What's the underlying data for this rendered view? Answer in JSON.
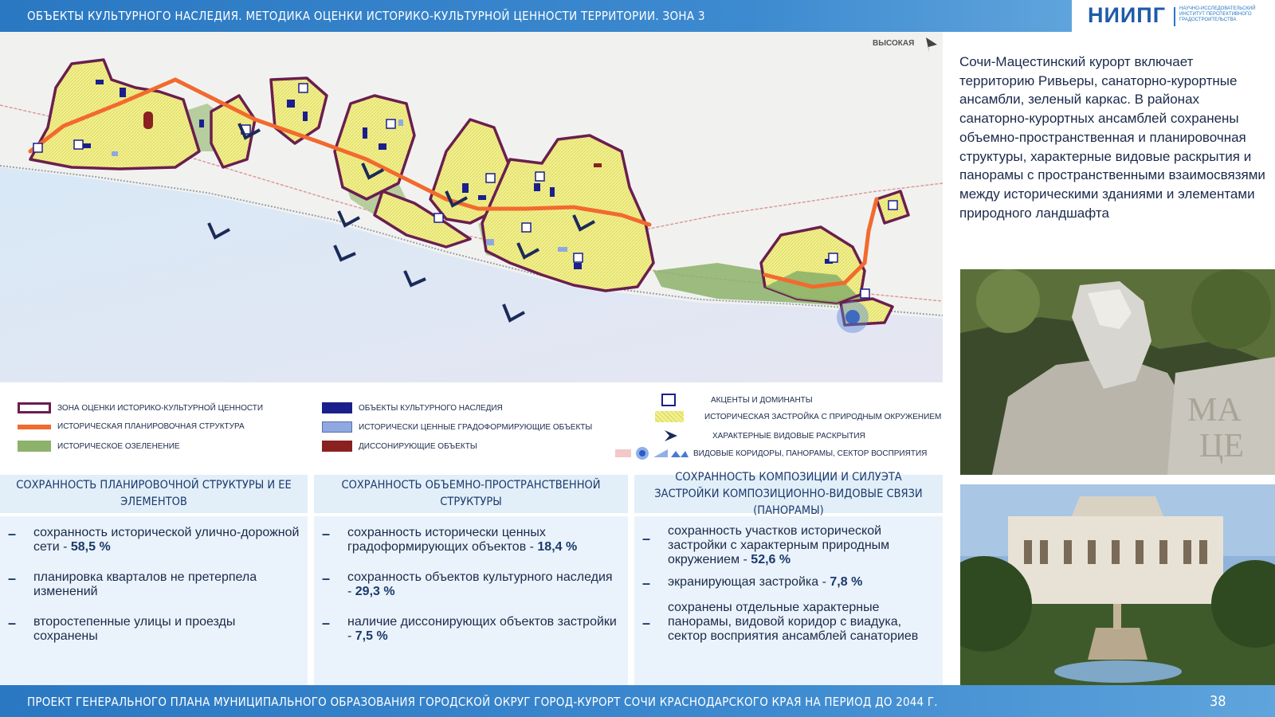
{
  "header": {
    "title": "ОБЪЕКТЫ КУЛЬТУРНОГО НАСЛЕДИЯ. МЕТОДИКА ОЦЕНКИ ИСТОРИКО-КУЛЬТУРНОЙ ЦЕННОСТИ ТЕРРИТОРИИ. ЗОНА 3",
    "logo_text": "НИИПГ",
    "logo_subtitle": "НАУЧНО-ИССЛЕДОВАТЕЛЬСКИЙ ИНСТИТУТ ПЕРСПЕКТИВНОГО ГРАДОСТРОИТЕЛЬСТВА"
  },
  "map": {
    "label_high": "ВЫСОКАЯ"
  },
  "legend": {
    "zone": "ЗОНА ОЦЕНКИ ИСТОРИКО-КУЛЬТУРНОЙ ЦЕННОСТИ",
    "planning": "ИСТОРИЧЕСКАЯ ПЛАНИРОВОЧНАЯ СТРУКТУРА",
    "greening": "ИСТОРИЧЕСКОЕ ОЗЕЛЕНЕНИЕ",
    "heritage": "ОБЪЕКТЫ КУЛЬТУРНОГО НАСЛЕДИЯ",
    "valuable": "ИСТОРИЧЕСКИ ЦЕННЫЕ ГРАДОФОРМИРУЮЩИЕ ОБЪЕКТЫ",
    "dissonant": "ДИССОНИРУЮЩИЕ ОБЪЕКТЫ",
    "accents": "АКЦЕНТЫ И ДОМИНАНТЫ",
    "historic_build": "ИСТОРИЧЕСКАЯ ЗАСТРОЙКА С ПРИРОДНЫМ ОКРУЖЕНИЕМ",
    "views": "ХАРАКТЕРНЫЕ ВИДОВЫЕ РАСКРЫТИЯ",
    "corridors": "ВИДОВЫЕ КОРИДОРЫ, ПАНОРАМЫ, СЕКТОР ВОСПРИЯТИЯ",
    "colors": {
      "zone": "#6b1e4e",
      "planning": "#f26a2e",
      "greening": "#8db26a",
      "heritage": "#1a1f8c",
      "valuable": "#8fa8e0",
      "dissonant": "#8a2020",
      "historic": "#f0f08a"
    }
  },
  "description": "Сочи-Мацестинский курорт включает территорию Ривьеры, санаторно-курортные ансамбли, зеленый каркас. В районах санаторно-курортных ансамблей сохранены  объемно-пространственная и планировочная структуры, характерные видовые раскрытия и панорамы с пространственными взаимосвязями между историческими зданиями и элементами природного ландшафта",
  "columns": [
    {
      "title": "СОХРАННОСТЬ ПЛАНИРОВОЧНОЙ СТРУКТУРЫ И ЕЕ ЭЛЕМЕНТОВ",
      "items": [
        {
          "text": "сохранность исторической улично-дорожной сети - ",
          "value": "58,5 %"
        },
        {
          "text": "планировка кварталов не претерпела изменений",
          "value": ""
        },
        {
          "text": "второстепенные улицы и проезды сохранены",
          "value": ""
        }
      ]
    },
    {
      "title": "СОХРАННОСТЬ ОБЪЕМНО-ПРОСТРАНСТВЕННОЙ СТРУКТУРЫ",
      "items": [
        {
          "text": "сохранность исторически ценных градоформирующих объектов - ",
          "value": "18,4 %"
        },
        {
          "text": "сохранность объектов культурного наследия - ",
          "value": "29,3 %"
        },
        {
          "text": "наличие диссонирующих объектов застройки - ",
          "value": "7,5 %"
        }
      ]
    },
    {
      "title": "СОХРАННОСТЬ КОМПОЗИЦИИ И СИЛУЭТА ЗАСТРОЙКИ КОМПОЗИЦИОННО-ВИДОВЫЕ СВЯЗИ (ПАНОРАМЫ)",
      "items": [
        {
          "text": "сохранность участков исторической застройки с характерным природным окружением - ",
          "value": "52,6 %"
        },
        {
          "text": "экранирующая застройка - ",
          "value": "7,8 %"
        },
        {
          "text": "сохранены отдельные характерные панорамы, видовой коридор с виадука, сектор восприятия ансамблей санаториев",
          "value": ""
        }
      ]
    }
  ],
  "footer": {
    "text": "ПРОЕКТ ГЕНЕРАЛЬНОГО ПЛАНА  МУНИЦИПАЛЬНОГО ОБРАЗОВАНИЯ ГОРОДСКОЙ ОКРУГ ГОРОД-КУРОРТ СОЧИ КРАСНОДАРСКОГО КРАЯ НА ПЕРИОД ДО 2044 г.",
    "page": "38"
  }
}
